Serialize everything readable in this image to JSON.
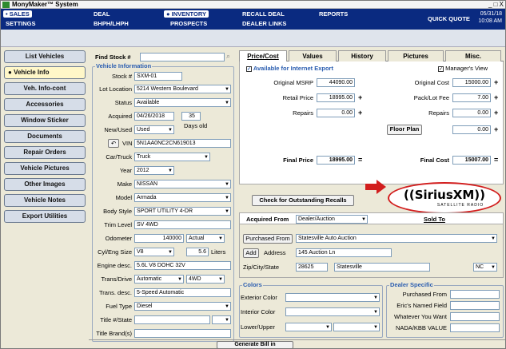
{
  "title": "MonyMaker™ System",
  "window_controls": "_ □ X",
  "nav": {
    "sales": "SALES",
    "settings": "SETTINGS",
    "deal": "DEAL",
    "bhph": "BHPH/LHPH",
    "inventory": "INVENTORY",
    "prospects": "PROSPECTS",
    "recall_deal": "RECALL DEAL",
    "dealer_links": "DEALER LINKS",
    "reports": "REPORTS",
    "quick_quote": "QUICK QUOTE",
    "date": "05/31/18",
    "time": "10:08 AM"
  },
  "sidebar": [
    "List Vehicles",
    "Vehicle Info",
    "Veh. Info-cont",
    "Accessories",
    "Window Sticker",
    "Documents",
    "Repair Orders",
    "Vehicle Pictures",
    "Other Images",
    "Vehicle Notes",
    "Export Utilities"
  ],
  "find_stock_label": "Find Stock #",
  "vehicle_info": {
    "title": "Vehicle Information",
    "stock_label": "Stock #",
    "stock": "SXM-01",
    "lot_label": "Lot Location",
    "lot": "5214 Western Boulevard",
    "status_label": "Status",
    "status": "Available",
    "acquired_label": "Acquired",
    "acquired": "04/26/2018",
    "days": "35",
    "days_label": "Days old",
    "newused_label": "New/Used",
    "newused": "Used",
    "vin_label": "VIN",
    "vin": "5N1AA0NC2CN619013",
    "cartruck_label": "Car/Truck",
    "cartruck": "Truck",
    "year_label": "Year",
    "year": "2012",
    "make_label": "Make",
    "make": "NISSAN",
    "model_label": "Model",
    "model": "Armada",
    "body_label": "Body Style",
    "body": "SPORT UTILITY 4-DR",
    "trim_label": "Trim Level",
    "trim": "SV 4WD",
    "odo_label": "Odometer",
    "odo": "140000",
    "odo_type": "Actual",
    "cyl_label": "Cyl/Eng Size",
    "cyl": "V8",
    "liters": "5.6",
    "liters_label": "Liters",
    "engdesc_label": "Engine desc.",
    "engdesc": "5.6L V8 DOHC 32V",
    "trans_label": "Trans/Drive",
    "trans": "Automatic",
    "drive": "4WD",
    "transdesc_label": "Trans. desc.",
    "transdesc": "5-Speed Automatic",
    "fuel_label": "Fuel Type",
    "fuel": "Diesel",
    "titlestate_label": "Title #/State",
    "brands_label": "Title Brand(s)"
  },
  "tabs": [
    "Price/Cost",
    "Values",
    "History",
    "Pictures",
    "Misc."
  ],
  "price": {
    "internet": "Available for Internet Export",
    "managers_view": "Manager's View",
    "msrp_label": "Original MSRP",
    "msrp": "44090.00",
    "retail_label": "Retail Price",
    "retail": "18995.00",
    "repairs_label": "Repairs",
    "repairs": "0.00",
    "orig_cost_label": "Original Cost",
    "orig_cost": "15000.00",
    "pack_label": "Pack/Lot Fee",
    "pack": "7.00",
    "repairs2": "0.00",
    "floor_label": "Floor Plan",
    "floor": "0.00",
    "final_price_label": "Final Price",
    "final_price": "18995.00",
    "final_cost_label": "Final Cost",
    "final_cost": "15007.00",
    "plus": "+",
    "eq": "="
  },
  "recalls_btn": "Check for Outstanding Recalls",
  "sirius": {
    "brand": "((SiriusXM))",
    "sub": "SATELLITE RADIO",
    "accent": "#d21e1e"
  },
  "acq": {
    "from_label": "Acquired From",
    "from": "Dealer/Auction",
    "sold_to": "Sold To",
    "purchased_from_btn": "Purchased From",
    "purchased_from": "Statesville Auto Auction",
    "add_btn": "Add",
    "address_label": "Address",
    "address": "145 Auction Ln",
    "zip_label": "Zip/City/State",
    "zip": "28625",
    "city": "Statesville",
    "state": "NC"
  },
  "colors": {
    "title": "Colors",
    "ext": "Exterior Color",
    "int": "Interior Color",
    "lower": "Lower/Upper"
  },
  "dealer": {
    "title": "Dealer Specific",
    "f1": "Purchased From",
    "f2": "Eric's Named Field",
    "f3": "Whatever You Want",
    "f4": "NADA/KBB VALUE"
  },
  "gen_bill": "Generate Bill in"
}
